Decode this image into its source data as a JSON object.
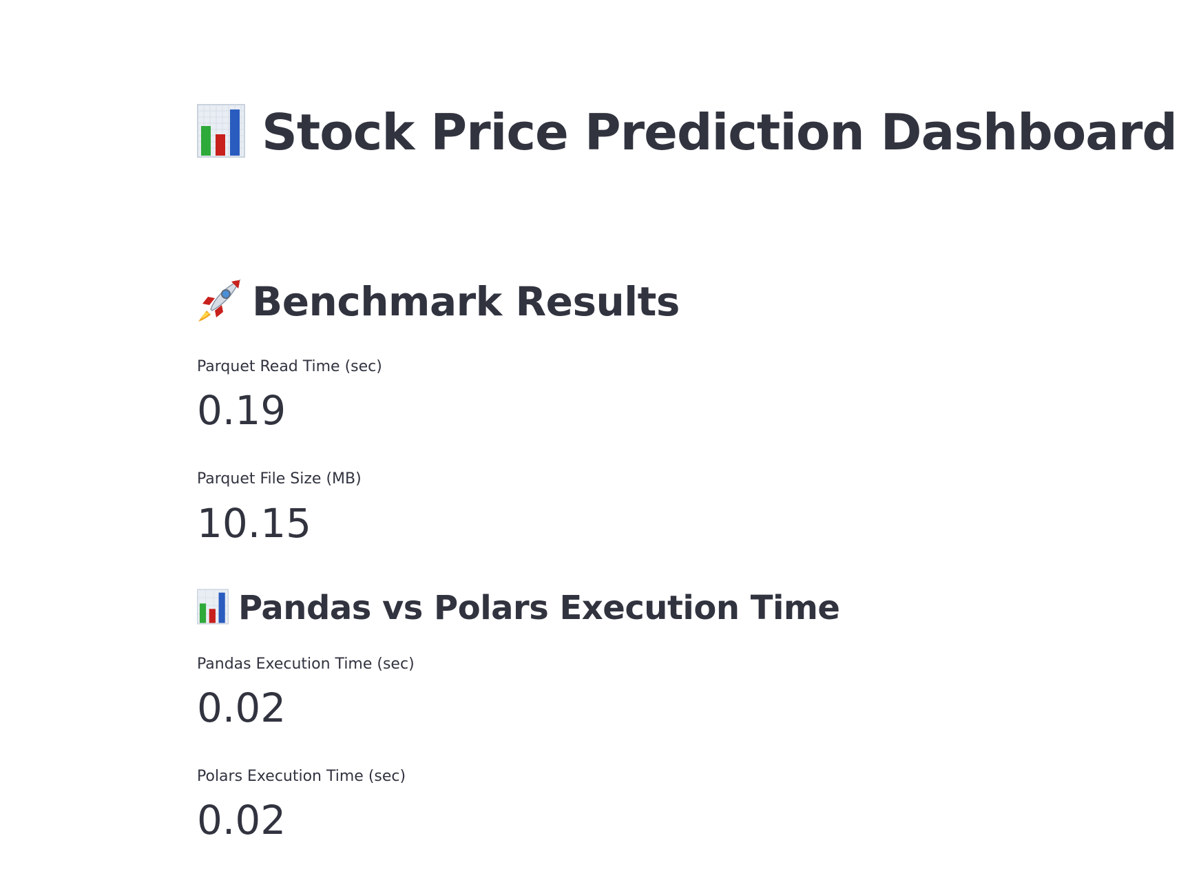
{
  "page": {
    "title": "Stock Price Prediction Dashboard",
    "title_icon": "bar-chart-icon"
  },
  "sections": {
    "benchmark": {
      "heading": "Benchmark Results",
      "icon": "rocket-icon",
      "metrics": [
        {
          "label": "Parquet Read Time (sec)",
          "value": "0.19"
        },
        {
          "label": "Parquet File Size (MB)",
          "value": "10.15"
        }
      ]
    },
    "comparison": {
      "heading": "Pandas vs Polars Execution Time",
      "icon": "bar-chart-icon",
      "metrics": [
        {
          "label": "Pandas Execution Time (sec)",
          "value": "0.02"
        },
        {
          "label": "Polars Execution Time (sec)",
          "value": "0.02"
        }
      ]
    }
  },
  "colors": {
    "text": "#31333f",
    "background": "#ffffff",
    "bar_green": "#2eaa3a",
    "bar_red": "#c8201c",
    "bar_blue": "#2a5cbf"
  }
}
